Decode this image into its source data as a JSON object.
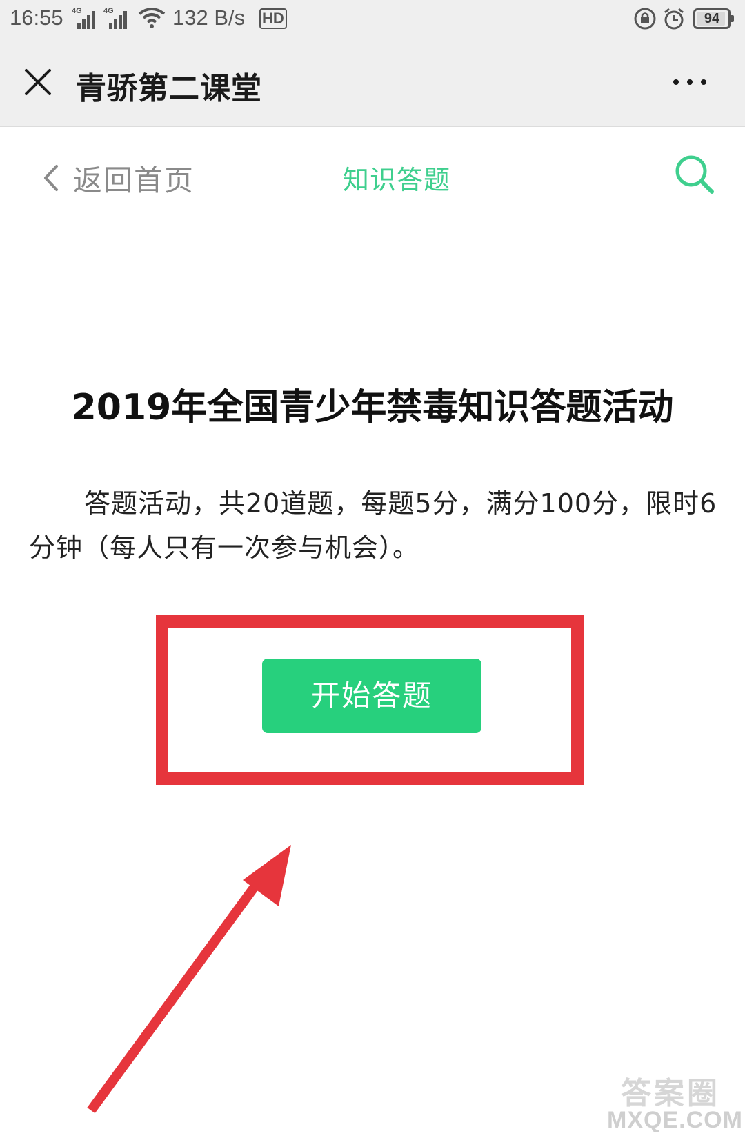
{
  "status_bar": {
    "time": "16:55",
    "network_1": "4G",
    "network_2": "4G",
    "speed": "132 B/s",
    "hd_label": "HD",
    "battery": "94",
    "battery_level": 0.94
  },
  "title_bar": {
    "title": "青骄第二课堂"
  },
  "page_nav": {
    "back_label": "返回首页",
    "title": "知识答题"
  },
  "content": {
    "heading": "2019年全国青少年禁毒知识答题活动",
    "description": "答题活动，共20道题，每题5分，满分100分，限时6分钟（每人只有一次参与机会）。",
    "start_button_label": "开始答题"
  },
  "watermark": {
    "logo_text": "答案圈",
    "domain": "MXQE.COM"
  },
  "colors": {
    "accent_green": "#3fcf8e",
    "button_green": "#27d07d",
    "highlight_red": "#e6353c"
  },
  "icons": {
    "close": "close-icon",
    "more": "more-icon",
    "back": "chevron-left-icon",
    "search": "search-icon"
  }
}
